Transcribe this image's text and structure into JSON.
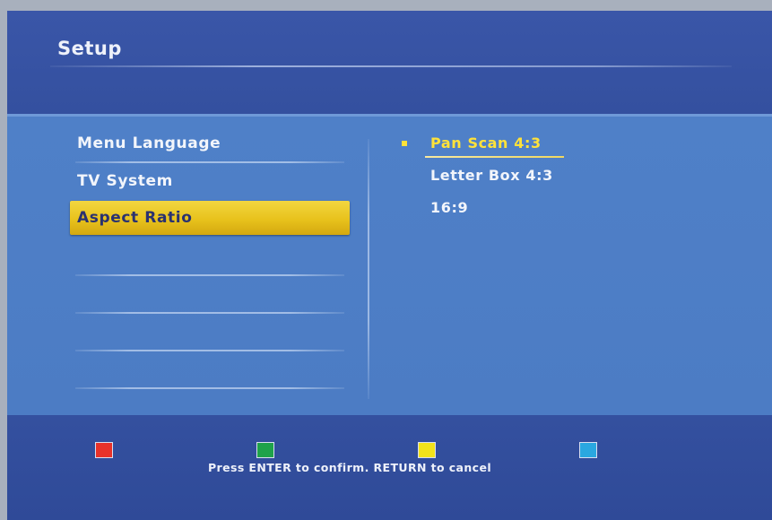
{
  "header": {
    "title": "Setup"
  },
  "menu": {
    "items": [
      {
        "label": "Menu Language"
      },
      {
        "label": "TV System"
      },
      {
        "label": "Aspect Ratio",
        "selected": true
      }
    ]
  },
  "options": {
    "items": [
      {
        "label": "Pan Scan 4:3",
        "active": true
      },
      {
        "label": "Letter Box 4:3"
      },
      {
        "label": "16:9"
      }
    ]
  },
  "footer": {
    "hint": "Press ENTER to confirm. RETURN to cancel",
    "keys": [
      {
        "name": "red",
        "color": "#e8322a"
      },
      {
        "name": "green",
        "color": "#1fa24a"
      },
      {
        "name": "yellow",
        "color": "#f2e21a"
      },
      {
        "name": "blue",
        "color": "#2aa8e0"
      }
    ]
  }
}
